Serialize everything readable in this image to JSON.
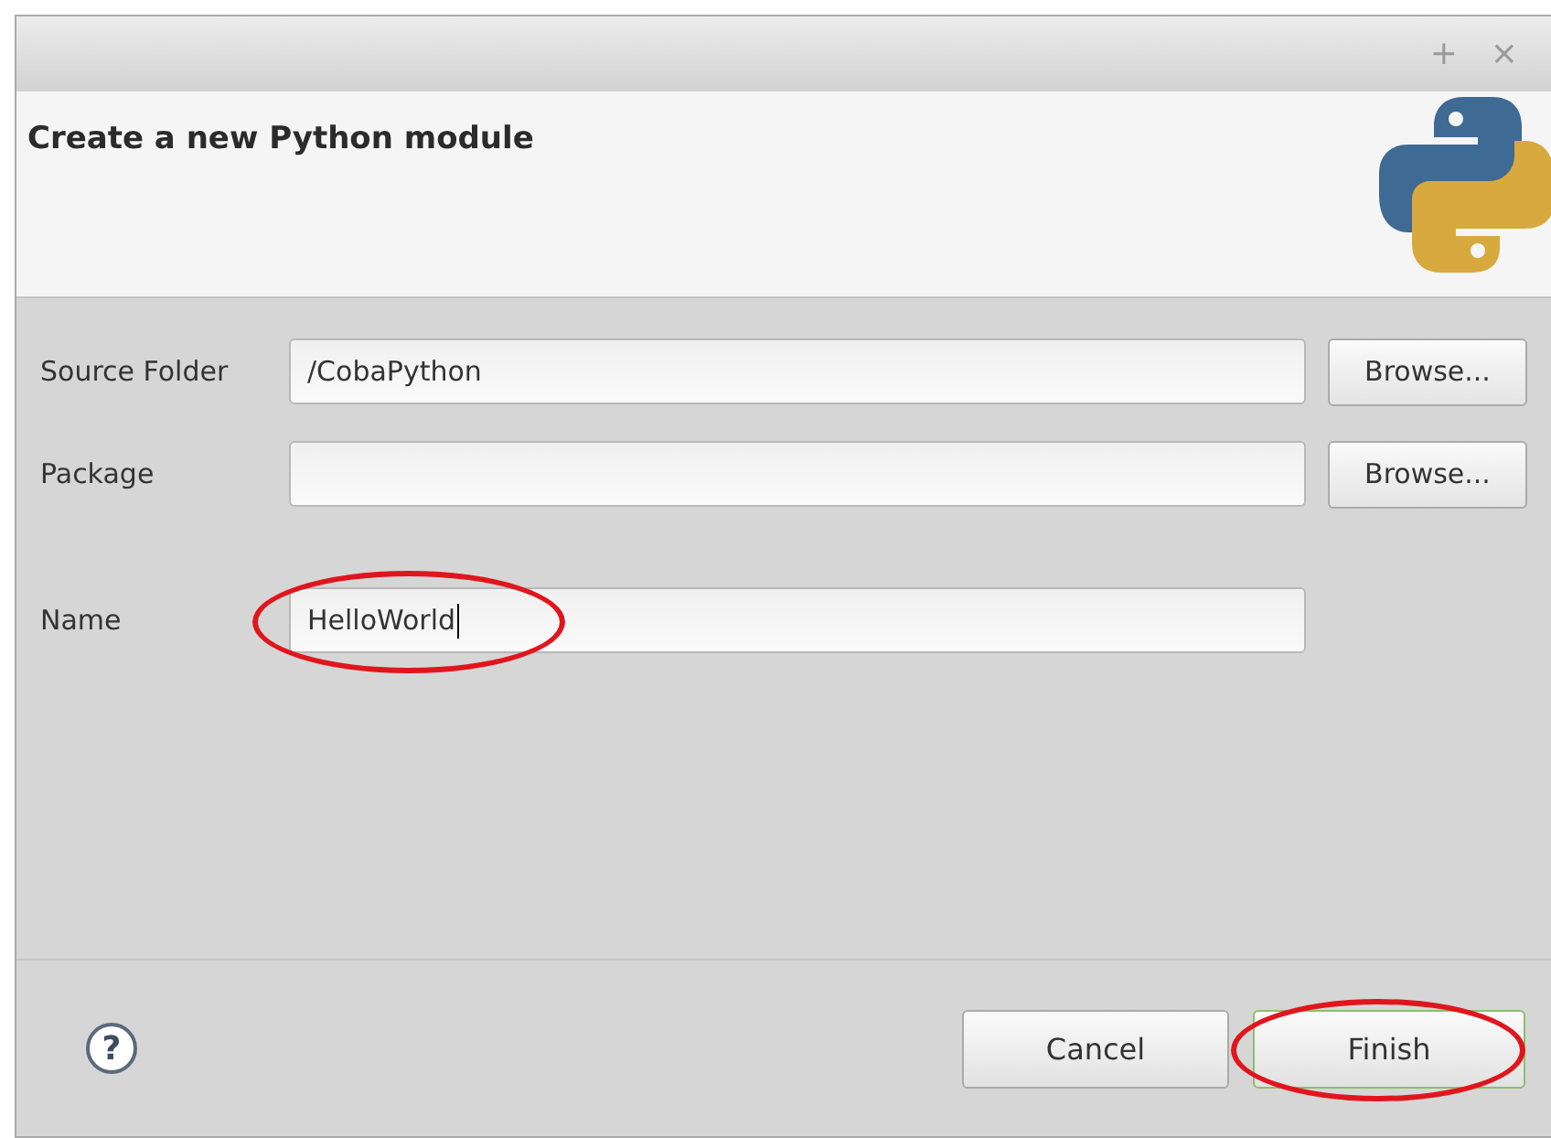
{
  "window": {
    "controls": [
      "+",
      "×"
    ]
  },
  "header": {
    "title": "Create a new Python module"
  },
  "sections": [
    [
      {
        "label": "Source Folder",
        "value": "/CobaPython",
        "button": "Browse...",
        "circled": false,
        "focused": false
      },
      {
        "label": "Package",
        "button": "Browse...",
        "circled": false,
        "focused": false
      }
    ],
    [
      {
        "label": "Name",
        "value": "HelloWorld",
        "circled": true,
        "focused": true
      }
    ]
  ],
  "footer": {
    "help": "?",
    "buttons": [
      {
        "label": "Cancel",
        "default": false,
        "circled": false
      },
      {
        "label": "Finish",
        "default": true,
        "circled": true
      }
    ]
  }
}
